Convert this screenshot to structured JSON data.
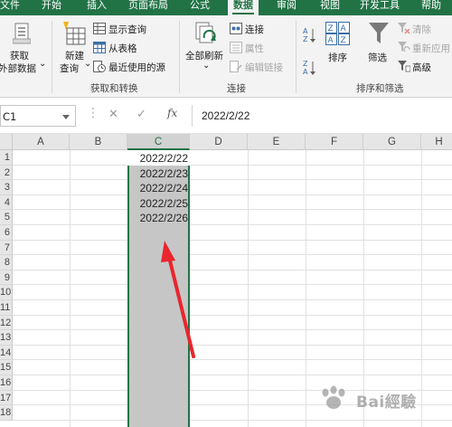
{
  "ribbon_tabs": [
    {
      "label": "文件",
      "active": false
    },
    {
      "label": "开始",
      "active": false
    },
    {
      "label": "插入",
      "active": false
    },
    {
      "label": "页面布局",
      "active": false
    },
    {
      "label": "公式",
      "active": false
    },
    {
      "label": "数据",
      "active": true
    },
    {
      "label": "审阅",
      "active": false
    },
    {
      "label": "视图",
      "active": false
    },
    {
      "label": "开发工具",
      "active": false
    },
    {
      "label": "帮助",
      "active": false
    }
  ],
  "ribbon": {
    "get_transform": {
      "group_label": "获取和转换",
      "get_data": {
        "line1": "获取",
        "line2": "外部数据",
        "caret": "⌄"
      },
      "new_query": {
        "line1": "新建",
        "line2": "查询",
        "caret": "⌄"
      },
      "show_queries": "显示查询",
      "from_table": "从表格",
      "recent_sources": "最近使用的源"
    },
    "connections": {
      "group_label": "连接",
      "refresh_all": {
        "label": "全部刷新",
        "caret": "⌄"
      },
      "connections": "连接",
      "properties": "属性",
      "edit_links": "编辑链接"
    },
    "sort_filter": {
      "group_label": "排序和筛选",
      "sort": "排序",
      "filter": "筛选",
      "clear": "清除",
      "reapply": "重新应用",
      "advanced": "高级"
    }
  },
  "formula_bar": {
    "name_box": "C1",
    "cancel_glyph": "✕",
    "enter_glyph": "✓",
    "fx_label": "fx",
    "formula": "2022/2/22"
  },
  "sheet": {
    "columns": [
      "A",
      "B",
      "C",
      "D",
      "E",
      "F",
      "G",
      "H"
    ],
    "selected_column": "C",
    "row_numbers": [
      "1",
      "2",
      "3",
      "4",
      "5",
      "6",
      "7",
      "8",
      "9",
      "10",
      "11",
      "12",
      "13",
      "14",
      "15",
      "16",
      "17",
      "18"
    ],
    "column_c_values": [
      "2022/2/22",
      "2022/2/23",
      "2022/2/24",
      "2022/2/25",
      "2022/2/26"
    ]
  },
  "colors": {
    "excel_green": "#217346",
    "arrow_red": "#e8262c",
    "selection_gray": "#c6c6c6"
  },
  "watermark": {
    "text": "Bai經驗"
  }
}
